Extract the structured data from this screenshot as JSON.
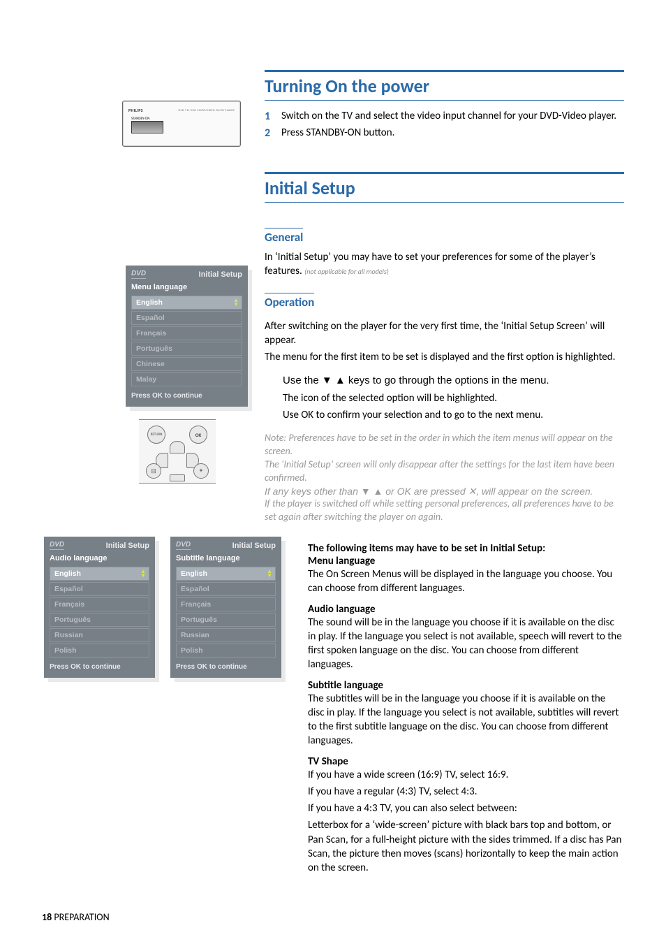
{
  "section1": {
    "heading": "Turning On the power",
    "step1_num": "1",
    "step1": "Switch on the TV and select the video input channel for your DVD-Video player.",
    "step2_num": "2",
    "step2": "Press STANDBY-ON button."
  },
  "player_illus": {
    "brand": "PHILIPS",
    "model": "DVD 711    DVD VIDEO/VIDEO CD/CD PLAYER",
    "standby_label": "STANDBY-ON"
  },
  "section2": {
    "heading": "Initial Setup",
    "general_h": "General",
    "general_p": "In ‘Initial Setup’ you may have to set your preferences for some of the player’s features.",
    "general_note": "(not applicable for all models)",
    "operation_h": "Operation",
    "op_p1": "After switching on the player for the very first time, the ‘Initial Setup Screen’ will appear.",
    "op_p2": "The menu for the first item to be set is displayed and the first option is highlighted.",
    "op_b1": "Use the ▼ ▲ keys to go through the options in the menu.",
    "op_b2": "The icon of the selected option will be highlighted.",
    "op_b3": "Use OK to confirm your selection and to go to the next menu.",
    "note1": "Note: Preferences have to be set in the order in which the item menus will appear on the screen.",
    "note2": "The ‘Initial Setup’ screen will only disappear after the settings for the last item have been confirmed.",
    "note3": "If any keys other than ▼ ▲ or OK are pressed ✕, will appear on the screen.",
    "note4": "If the player is switched off while setting personal preferences, all preferences have to be set again after switching the player on again.",
    "items_h": "The following items may have to be set in Initial Setup:",
    "menu_lang_h": "Menu language",
    "menu_lang_p": " The On Screen Menus will be displayed in the language you choose. You can choose from different languages.",
    "audio_lang_h": "Audio language",
    "audio_lang_p": "The sound will be in the language you choose if it is available on the disc in play. If the language you select is not available, speech will revert to the first spoken language on the disc. You can choose from different languages.",
    "sub_lang_h": "Subtitle language",
    "sub_lang_p": "The subtitles will be in the language you choose if it is available on the disc in play. If the language you select is not available, subtitles will revert to the first subtitle language on the disc. You can choose from different languages.",
    "tv_shape_h": "TV Shape",
    "tv_shape_p1": "If you have a wide screen (16:9) TV, select 16:9.",
    "tv_shape_p2": "If you have a regular (4:3) TV, select 4:3.",
    "tv_shape_p3": "If you have a 4:3 TV, you can also select between:",
    "tv_shape_p4": "Letterbox for a ‘wide-screen’ picture with black bars top and bottom, or Pan Scan, for a full-height picture with the sides trimmed. If a disc has Pan Scan, the picture then moves (scans) horizontally to keep the main action on the screen."
  },
  "osd_menu": {
    "dvd": "DVD",
    "title": "Initial Setup",
    "sub": "Menu language",
    "items": [
      "English",
      "Español",
      "Français",
      "Português",
      "Chinese",
      "Malay"
    ],
    "foot": "Press OK to continue"
  },
  "osd_audio": {
    "dvd": "DVD",
    "title": "Initial Setup",
    "sub": "Audio language",
    "items": [
      "English",
      "Español",
      "Français",
      "Português",
      "Russian",
      "Polish"
    ],
    "foot": "Press OK to continue"
  },
  "osd_subtitle": {
    "dvd": "DVD",
    "title": "Initial Setup",
    "sub": "Subtitle language",
    "items": [
      "English",
      "Español",
      "Français",
      "Português",
      "Russian",
      "Polish"
    ],
    "foot": "Press OK to continue"
  },
  "remote": {
    "return": "RETURN",
    "ok": "OK"
  },
  "footer": {
    "num": "18",
    "label": " PREPARATION"
  }
}
